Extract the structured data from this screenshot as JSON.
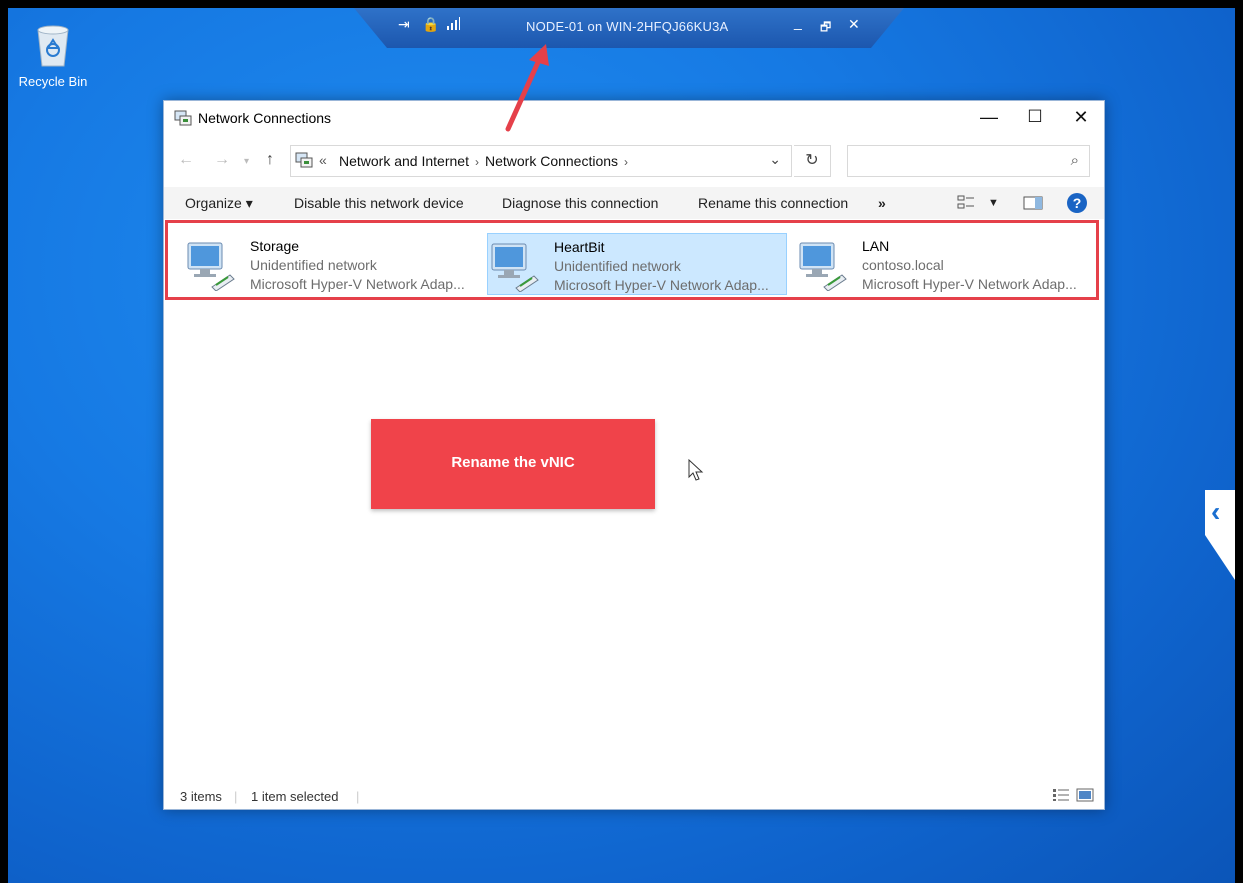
{
  "rdp": {
    "title": "NODE-01 on WIN-2HFQJ66KU3A",
    "minimize": "_",
    "restore": "🗗",
    "close": "✕"
  },
  "desktop": {
    "recycle_bin_label": "Recycle Bin"
  },
  "window": {
    "title": "Network Connections",
    "minimize": "—",
    "maximize": "☐",
    "close": "✕",
    "breadcrumb": {
      "prefix": "«",
      "items": [
        "Network and Internet",
        "Network Connections"
      ],
      "sep": "›"
    },
    "commands": {
      "organize": "Organize ▾",
      "disable": "Disable this network device",
      "diagnose": "Diagnose this connection",
      "rename": "Rename this connection",
      "more": "»",
      "help": "?"
    },
    "items": [
      {
        "name": "Storage",
        "network": "Unidentified network",
        "adapter": "Microsoft Hyper-V Network Adap...",
        "selected": false
      },
      {
        "name": "HeartBit",
        "network": "Unidentified network",
        "adapter": "Microsoft Hyper-V Network Adap...",
        "selected": true
      },
      {
        "name": "LAN",
        "network": "contoso.local",
        "adapter": "Microsoft Hyper-V Network Adap...",
        "selected": false
      }
    ],
    "status": {
      "count": "3 items",
      "selected": "1 item selected"
    }
  },
  "overlay": {
    "callout": "Rename the vNIC",
    "accent": "#f0434a"
  }
}
